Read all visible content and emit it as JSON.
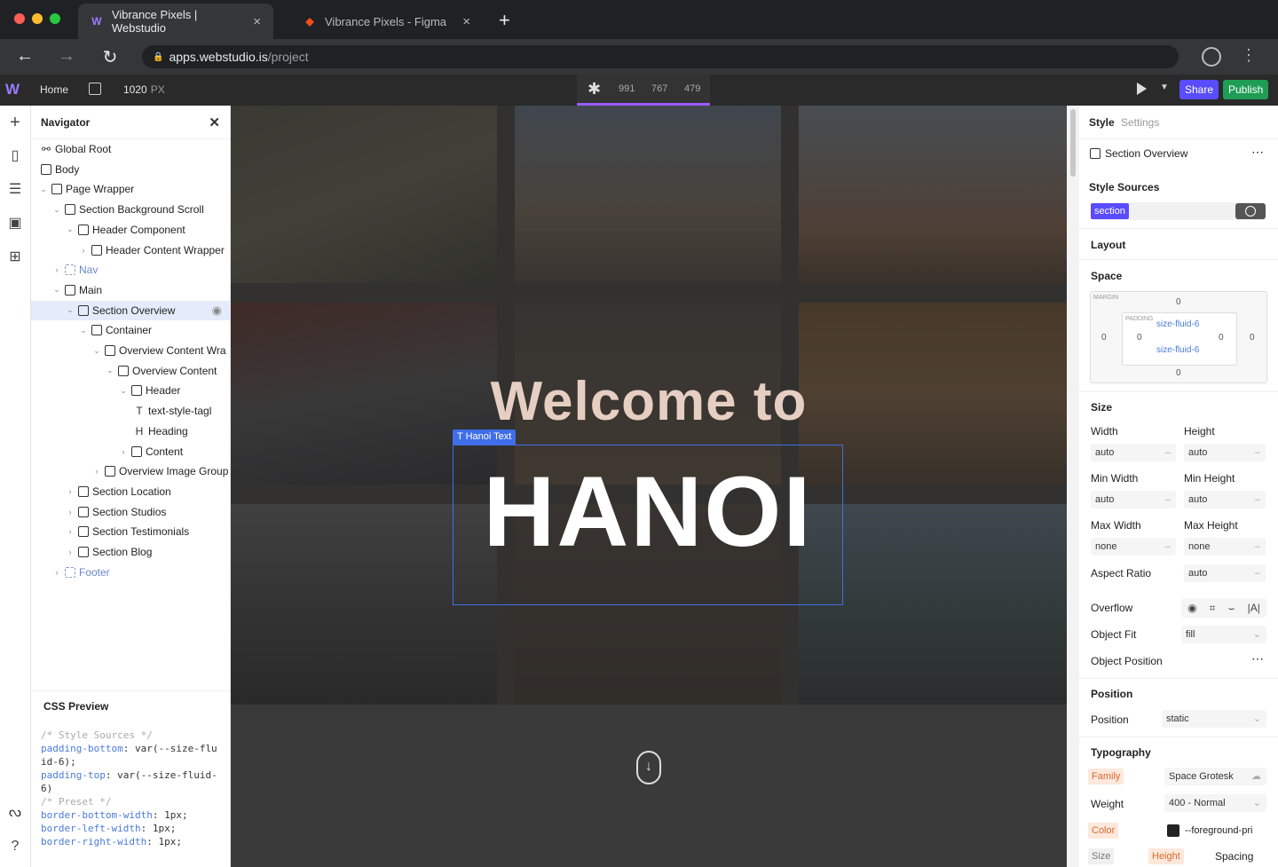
{
  "browser": {
    "tabs": [
      {
        "title": "Vibrance Pixels | Webstudio",
        "active": true
      },
      {
        "title": "Vibrance Pixels - Figma",
        "active": false
      }
    ],
    "url_host": "apps.webstudio.is",
    "url_path": "/project"
  },
  "toolbar": {
    "home_label": "Home",
    "breakpoint_value": "1020",
    "breakpoint_unit": "PX",
    "breakpoints": [
      "991",
      "767",
      "479"
    ],
    "share_label": "Share",
    "publish_label": "Publish"
  },
  "navigator": {
    "title": "Navigator",
    "tree": [
      {
        "label": "Global Root",
        "depth": 0,
        "icon": "global-root-icon"
      },
      {
        "label": "Body",
        "depth": 0,
        "icon": "body-icon"
      },
      {
        "label": "Page Wrapper",
        "depth": 0,
        "expanded": true
      },
      {
        "label": "Section Background Scroll",
        "depth": 1,
        "expanded": true
      },
      {
        "label": "Header Component",
        "depth": 2,
        "expanded": true
      },
      {
        "label": "Header Content Wrapper",
        "depth": 3,
        "expanded": false
      },
      {
        "label": "Nav",
        "depth": 1,
        "expanded": false,
        "slot": true
      },
      {
        "label": "Main",
        "depth": 1,
        "expanded": true
      },
      {
        "label": "Section Overview",
        "depth": 2,
        "expanded": true,
        "selected": true
      },
      {
        "label": "Container",
        "depth": 3,
        "expanded": true
      },
      {
        "label": "Overview Content Wra",
        "depth": 4,
        "expanded": true
      },
      {
        "label": "Overview Content",
        "depth": 5,
        "expanded": true
      },
      {
        "label": "Header",
        "depth": 6,
        "expanded": true
      },
      {
        "label": "text-style-tagl",
        "depth": 7,
        "icon": "text-icon"
      },
      {
        "label": "Heading",
        "depth": 7,
        "icon": "heading-icon"
      },
      {
        "label": "Content",
        "depth": 6,
        "expanded": false
      },
      {
        "label": "Overview Image Group",
        "depth": 4,
        "expanded": false
      },
      {
        "label": "Section Location",
        "depth": 2,
        "expanded": false
      },
      {
        "label": "Section Studios",
        "depth": 2,
        "expanded": false
      },
      {
        "label": "Section Testimonials",
        "depth": 2,
        "expanded": false
      },
      {
        "label": "Section Blog",
        "depth": 2,
        "expanded": false
      },
      {
        "label": "Footer",
        "depth": 1,
        "expanded": false,
        "slot": true
      }
    ],
    "css_preview": {
      "title": "CSS Preview",
      "lines": [
        {
          "type": "comment",
          "text": "/* Style Sources */"
        },
        {
          "type": "decl",
          "prop": "padding-bottom",
          "value": "var(--size-fluid-6);"
        },
        {
          "type": "decl",
          "prop": "padding-top",
          "value": "var(--size-fluid-6)"
        },
        {
          "type": "comment",
          "text": "/* Preset */"
        },
        {
          "type": "decl",
          "prop": "border-bottom-width",
          "value": "1px;"
        },
        {
          "type": "decl",
          "prop": "border-left-width",
          "value": "1px;"
        },
        {
          "type": "decl",
          "prop": "border-right-width",
          "value": "1px;"
        }
      ]
    }
  },
  "canvas": {
    "welcome_text": "Welcome to",
    "selected_label": "Hanoi Text",
    "hanoi_text": "HANOI"
  },
  "style_panel": {
    "tab_style": "Style",
    "tab_settings": "Settings",
    "instance_name": "Section Overview",
    "style_sources_title": "Style Sources",
    "source_chip": "section",
    "layout_title": "Layout",
    "space_title": "Space",
    "margin_label": "MARGIN",
    "padding_label": "PADDING",
    "margin_top": "0",
    "margin_right": "0",
    "margin_bottom": "0",
    "margin_left": "0",
    "padding_top": "size-fluid-6",
    "padding_bottom": "size-fluid-6",
    "padding_left": "0",
    "padding_right": "0",
    "size_title": "Size",
    "width_label": "Width",
    "width_value": "auto",
    "height_label": "Height",
    "height_value": "auto",
    "min_width_label": "Min Width",
    "min_width_value": "auto",
    "min_height_label": "Min Height",
    "min_height_value": "auto",
    "max_width_label": "Max Width",
    "max_width_value": "none",
    "max_height_label": "Max Height",
    "max_height_value": "none",
    "aspect_label": "Aspect Ratio",
    "aspect_value": "auto",
    "overflow_label": "Overflow",
    "object_fit_label": "Object Fit",
    "object_fit_value": "fill",
    "object_position_label": "Object Position",
    "position_title": "Position",
    "position_label": "Position",
    "position_value": "static",
    "typography_title": "Typography",
    "family_label": "Family",
    "family_value": "Space Grotesk",
    "weight_label": "Weight",
    "weight_value": "400 - Normal",
    "color_label": "Color",
    "color_value": "--foreground-pri",
    "size_label": "Size",
    "line_height_label": "Height",
    "spacing_label": "Spacing"
  }
}
